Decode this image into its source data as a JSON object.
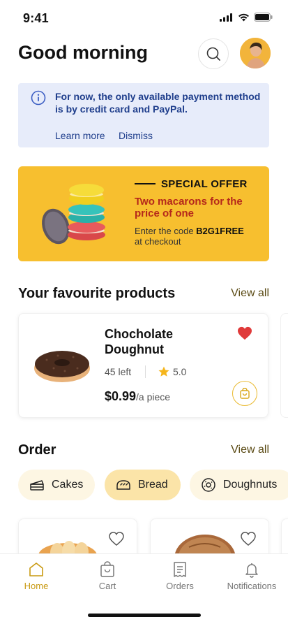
{
  "status": {
    "time": "9:41"
  },
  "header": {
    "greeting": "Good morning"
  },
  "notice": {
    "text": "For now, the only available payment method is by credit card and PayPal.",
    "learn_more": "Learn more",
    "dismiss": "Dismiss"
  },
  "offer": {
    "eyebrow": "SPECIAL OFFER",
    "headline": "Two macarons for the price of one",
    "desc_prefix": "Enter the code ",
    "code": "B2G1FREE",
    "desc_suffix": "at checkout"
  },
  "favourites": {
    "title": "Your favourite products",
    "view_all": "View all",
    "item": {
      "name": "Chocholate Doughnut",
      "stock": "45 left",
      "rating": "5.0",
      "price": "$0.99",
      "unit": "/a piece"
    }
  },
  "order": {
    "title": "Order",
    "view_all": "View all",
    "chips": [
      {
        "label": "Cakes",
        "icon": "cake-icon"
      },
      {
        "label": "Bread",
        "icon": "bread-icon",
        "active": true
      },
      {
        "label": "Doughnuts",
        "icon": "doughnut-icon"
      }
    ]
  },
  "tabs": [
    {
      "label": "Home",
      "icon": "home-icon",
      "active": true
    },
    {
      "label": "Cart",
      "icon": "cart-icon"
    },
    {
      "label": "Orders",
      "icon": "receipt-icon"
    },
    {
      "label": "Notifications",
      "icon": "bell-icon"
    }
  ],
  "colors": {
    "accent": "#f7bf2f",
    "notice_bg": "#e7ecfa",
    "notice_text": "#1f3e8c",
    "offer_headline": "#b5281b",
    "heart": "#e03a3a",
    "active_tab": "#c99a12"
  }
}
